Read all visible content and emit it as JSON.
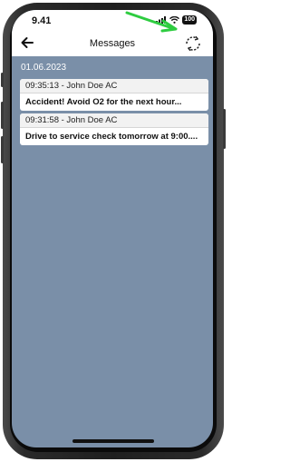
{
  "status_bar": {
    "time": "9.41",
    "battery": "100"
  },
  "navbar": {
    "title": "Messages",
    "back_icon": "arrow-left-icon",
    "refresh_icon": "refresh-icon"
  },
  "date": "01.06.2023",
  "messages": [
    {
      "time": "09:35:13",
      "sender": "John Doe AC",
      "header": "09:35:13  - John Doe AC",
      "text": "Accident! Avoid O2 for the next hour..."
    },
    {
      "time": "09:31:58",
      "sender": "John Doe AC",
      "header": "09:31:58  - John Doe AC",
      "text": "Drive to service check tomorrow at 9:00...."
    }
  ],
  "colors": {
    "background": "#7a8fa8",
    "annotation_arrow": "#2ecc40"
  }
}
